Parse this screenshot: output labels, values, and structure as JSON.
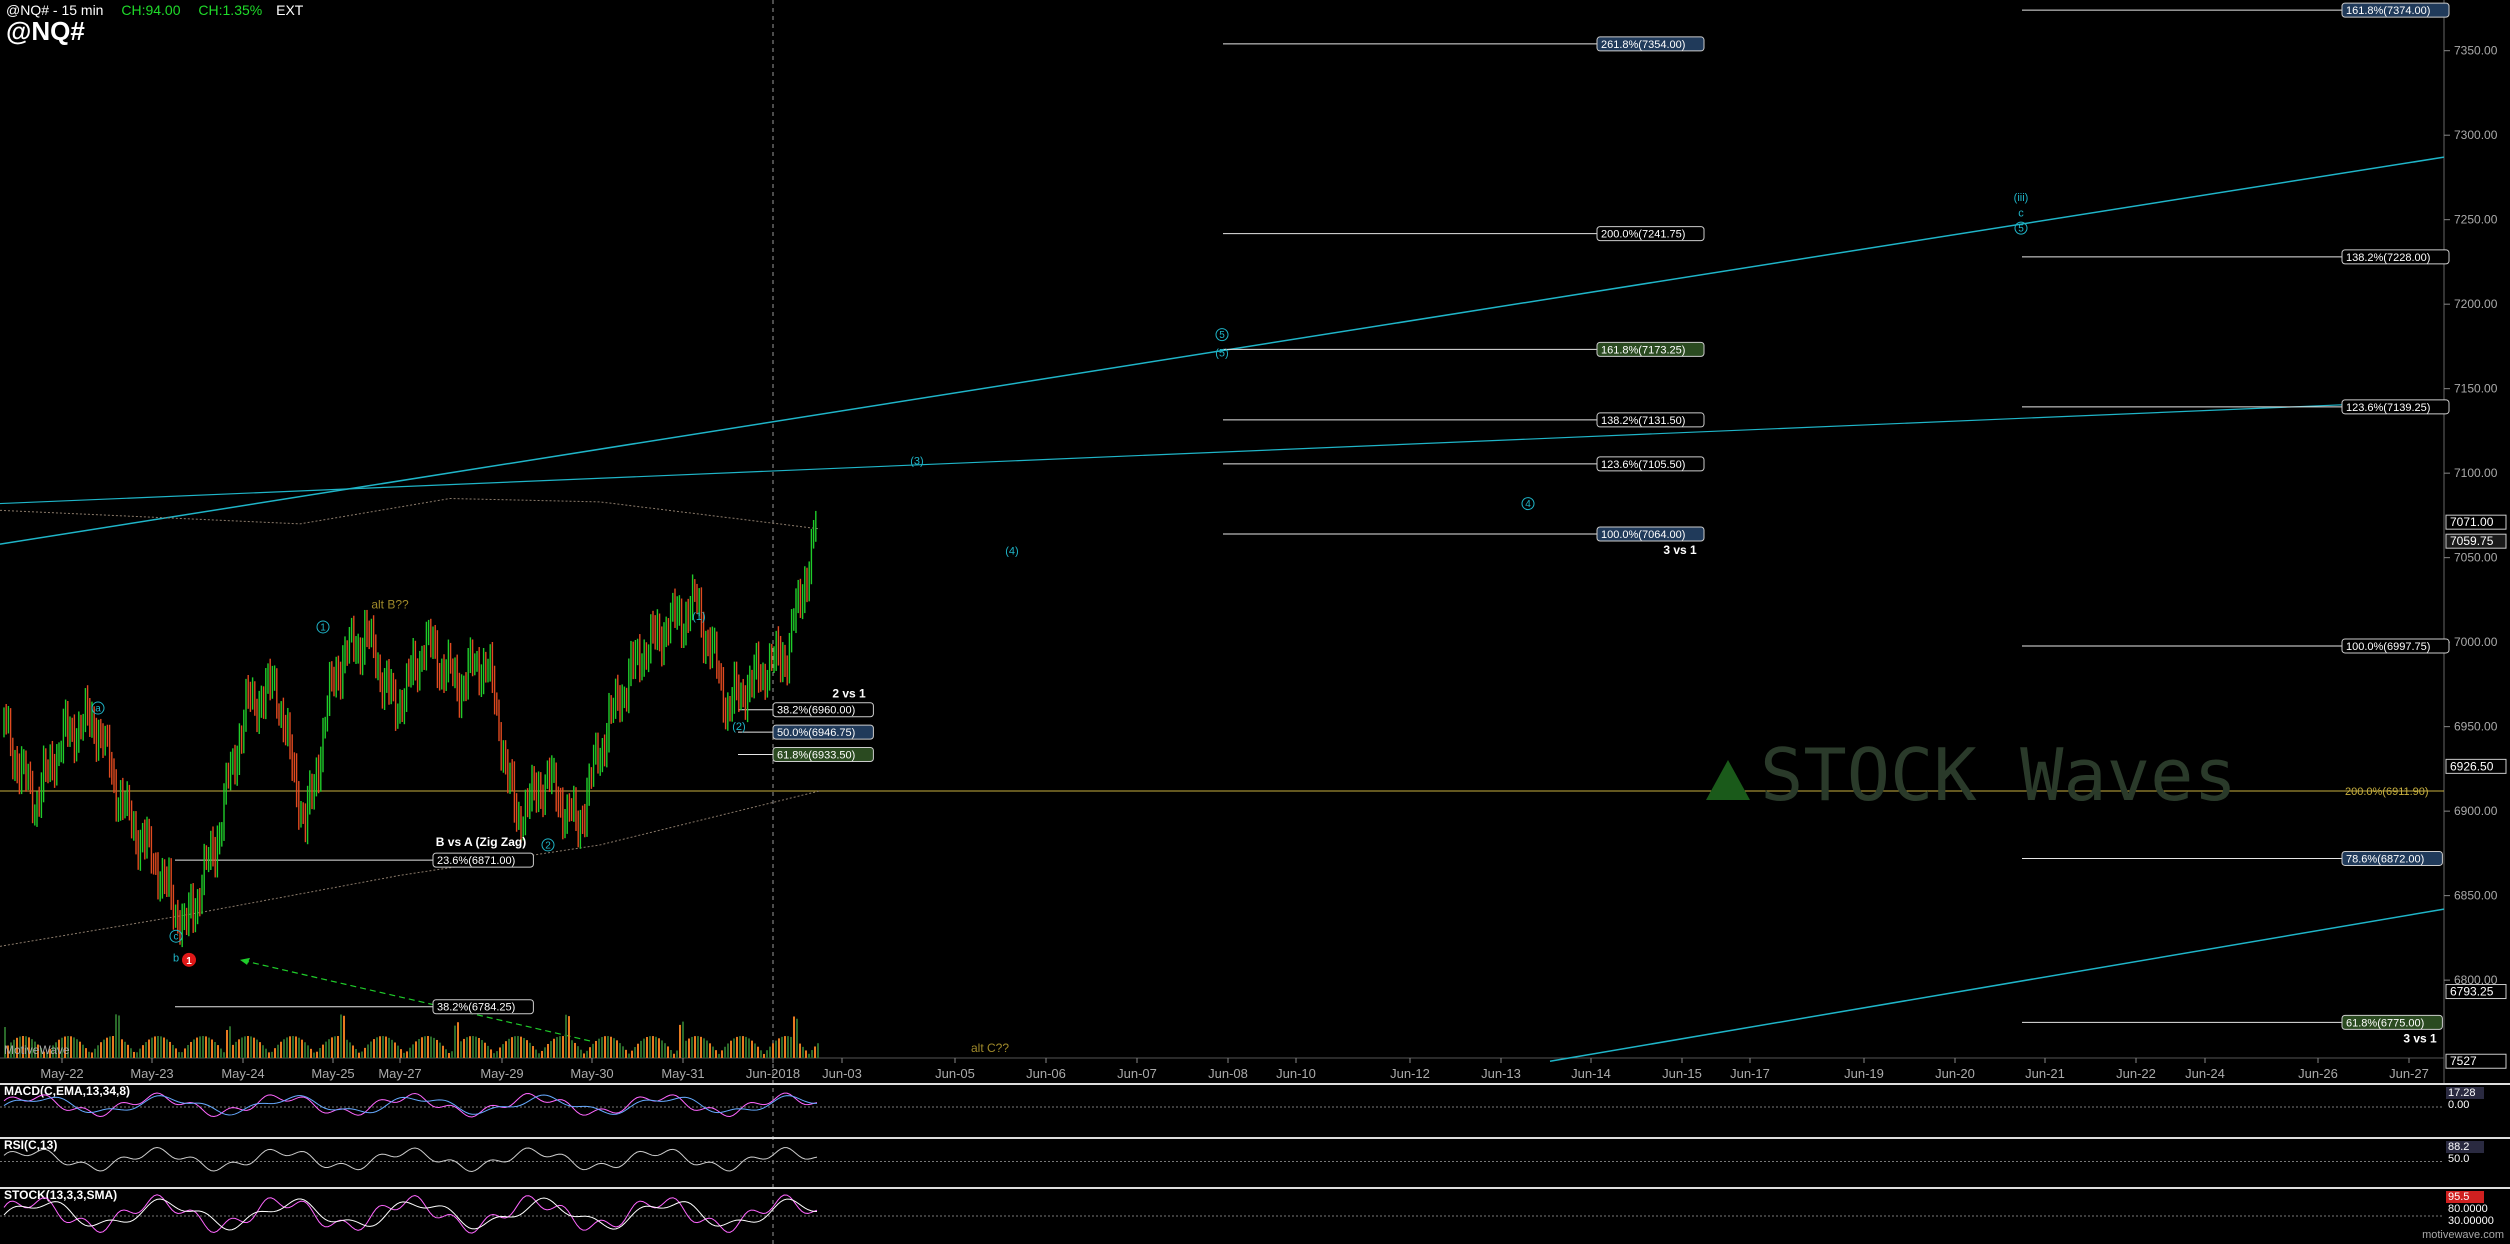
{
  "header": {
    "title": "@NQ# - 15 min",
    "change": "CH:94.00",
    "change_pct": "CH:1.35%",
    "session": "EXT",
    "symbol": "@NQ#"
  },
  "footer": {
    "watermark": "motivewave.com",
    "brand": "MotiveWave"
  },
  "colors": {
    "background": "#000000",
    "trendline": "#1fb5c8",
    "fib_line": "#e6e6e6",
    "up_bar": "#1fcc2a",
    "down_bar": "#e04a20",
    "label_text": "#1fb5c8",
    "alt_label": "#a08a2a",
    "macd": "#ff66ff",
    "signal": "#66aaff",
    "volume": "#e87a20"
  },
  "logo": {
    "brand": "STOCK Waves"
  },
  "chart_data": {
    "type": "line",
    "timeframe": "15 min",
    "x_dates": [
      "May-22",
      "May-23",
      "May-24",
      "May-25",
      "May-27",
      "May-29",
      "May-30",
      "May-31",
      "Jun-2018",
      "Jun-03",
      "Jun-05",
      "Jun-06",
      "Jun-07",
      "Jun-08",
      "Jun-10",
      "Jun-12",
      "Jun-13",
      "Jun-14",
      "Jun-15",
      "Jun-17",
      "Jun-19",
      "Jun-20",
      "Jun-21",
      "Jun-22",
      "Jun-24",
      "Jun-26",
      "Jun-27"
    ],
    "y_ticks": [
      7350.0,
      7300.0,
      7250.0,
      7200.0,
      7150.0,
      7100.0,
      7050.0,
      7000.0,
      6950.0,
      6900.0,
      6850.0,
      6800.0
    ],
    "ylim": [
      6748,
      7380
    ],
    "price_path": [
      {
        "d": "May-21",
        "p": 6950
      },
      {
        "d": "May-22a",
        "p": 6905
      },
      {
        "d": "May-22",
        "p": 6945
      },
      {
        "d": "May-22b",
        "p": 6955
      },
      {
        "d": "May-22c",
        "p": 6900
      },
      {
        "d": "May-23a",
        "p": 6870
      },
      {
        "d": "May-23",
        "p": 6830
      },
      {
        "d": "May-23b",
        "p": 6880
      },
      {
        "d": "May-23c",
        "p": 6960
      },
      {
        "d": "May-24",
        "p": 6975
      },
      {
        "d": "May-24a",
        "p": 6890
      },
      {
        "d": "May-24b",
        "p": 6985
      },
      {
        "d": "May-25",
        "p": 7005
      },
      {
        "d": "May-25a",
        "p": 6960
      },
      {
        "d": "May-27",
        "p": 7000
      },
      {
        "d": "May-27a",
        "p": 6975
      },
      {
        "d": "May-28",
        "p": 6990
      },
      {
        "d": "May-29",
        "p": 6895
      },
      {
        "d": "May-29a",
        "p": 6920
      },
      {
        "d": "May-30",
        "p": 6890
      },
      {
        "d": "May-30a",
        "p": 6950
      },
      {
        "d": "May-31",
        "p": 6990
      },
      {
        "d": "May-31a",
        "p": 7010
      },
      {
        "d": "May-31b",
        "p": 7022
      },
      {
        "d": "Jun-01a",
        "p": 6962
      },
      {
        "d": "Jun-2018",
        "p": 6980
      },
      {
        "d": "Jun-01b",
        "p": 6995
      },
      {
        "d": "Jun-02",
        "p": 7071
      }
    ],
    "last_price": "7071.00",
    "price_markers": [
      "7071.00",
      "7059.75",
      "6926.50",
      "6793.25",
      "7527"
    ],
    "fib_levels_mid": [
      {
        "label": "261.8%(7354.00)",
        "value": 7354.0
      },
      {
        "label": "200.0%(7241.75)",
        "value": 7241.75
      },
      {
        "label": "161.8%(7173.25)",
        "value": 7173.25
      },
      {
        "label": "138.2%(7131.50)",
        "value": 7131.5
      },
      {
        "label": "123.6%(7105.50)",
        "value": 7105.5
      },
      {
        "label": "100.0%(7064.00)",
        "value": 7064.0
      }
    ],
    "fib_levels_right": [
      {
        "label": "161.8%(7374.00)",
        "value": 7374.0
      },
      {
        "label": "138.2%(7228.00)",
        "value": 7228.0
      },
      {
        "label": "123.6%(7139.25)",
        "value": 7139.25
      },
      {
        "label": "100.0%(6997.75)",
        "value": 6997.75
      },
      {
        "label": "200.0%(6911.90)",
        "value": 6911.9
      },
      {
        "label": "78.6%(6872.00)",
        "value": 6872.0
      },
      {
        "label": "61.8%(6775.00)",
        "value": 6775.0
      }
    ],
    "fib_levels_left": [
      {
        "label": "38.2%(6960.00)",
        "value": 6960.0
      },
      {
        "label": "50.0%(6946.75)",
        "value": 6946.75
      },
      {
        "label": "61.8%(6933.50)",
        "value": 6933.5
      },
      {
        "label": "23.6%(6871.00)",
        "value": 6871.0
      },
      {
        "label": "38.2%(6784.25)",
        "value": 6784.25
      }
    ],
    "annotations": [
      "3 vs 1",
      "2 vs 1",
      "B vs A (Zig Zag)",
      "3 vs 1",
      "alt B??",
      "alt C??"
    ],
    "wave_labels": [
      "a",
      "1",
      "(1)",
      "(2)",
      "2",
      "c",
      "b",
      "(3)",
      "(4)",
      "4",
      "5",
      "(5)",
      "(iii)",
      "c",
      "5"
    ],
    "indicators": [
      {
        "name": "MACD(C,EMA,13,34,8)",
        "values": [
          "17.28",
          "0.00"
        ]
      },
      {
        "name": "RSI(C,13)",
        "values": [
          "88.2",
          "50.0"
        ]
      },
      {
        "name": "STOCK(13,3,3,SMA)",
        "values": [
          "95.5",
          "80.0000",
          "30.00000"
        ]
      }
    ]
  }
}
